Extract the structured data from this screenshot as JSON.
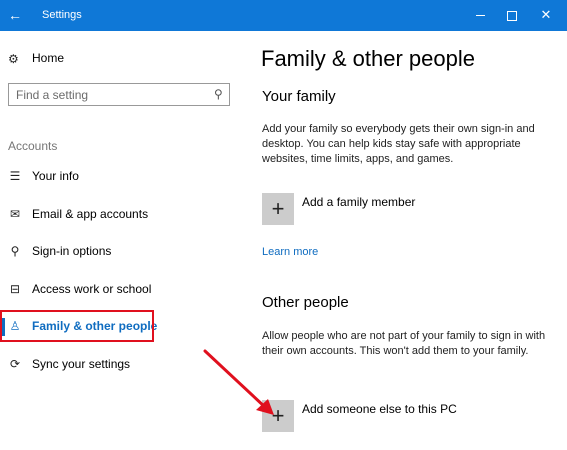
{
  "window": {
    "title": "Settings",
    "back_glyph": "←",
    "minimize_glyph": "",
    "close_glyph": "✕"
  },
  "sidebar": {
    "home_label": "Home",
    "home_icon": "gear-icon",
    "search_placeholder": "Find a setting",
    "section_label": "Accounts",
    "items": [
      {
        "label": "Your info",
        "icon": "person-card-icon",
        "glyph": "☰"
      },
      {
        "label": "Email & app accounts",
        "icon": "envelope-icon",
        "glyph": "✉"
      },
      {
        "label": "Sign-in options",
        "icon": "key-icon",
        "glyph": "⚲"
      },
      {
        "label": "Access work or school",
        "icon": "briefcase-icon",
        "glyph": "⊟"
      },
      {
        "label": "Family & other people",
        "icon": "person-icon",
        "glyph": "♙",
        "selected": true
      },
      {
        "label": "Sync your settings",
        "icon": "sync-icon",
        "glyph": "⟳"
      }
    ]
  },
  "main": {
    "title": "Family & other people",
    "your_family": {
      "heading": "Your family",
      "description": "Add your family so everybody gets their own sign-in and desktop. You can help kids stay safe with appropriate websites, time limits, apps, and games.",
      "add_label": "Add a family member",
      "learn_more": "Learn more"
    },
    "other_people": {
      "heading": "Other people",
      "description": "Allow people who are not part of your family to sign in with their own accounts. This won't add them to your family.",
      "add_label": "Add someone else to this PC"
    },
    "plus_glyph": "+"
  },
  "colors": {
    "titlebar": "#0f78d7",
    "accent": "#0f6cc0",
    "highlight": "#e0101e"
  }
}
